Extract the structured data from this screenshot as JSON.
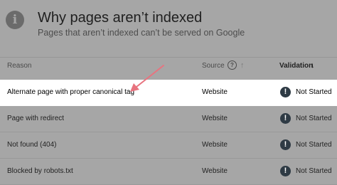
{
  "header": {
    "title": "Why pages aren’t indexed",
    "subtitle": "Pages that aren’t indexed can’t be served on Google",
    "icon_glyph": "i"
  },
  "columns": {
    "reason": "Reason",
    "source": "Source",
    "help_glyph": "?",
    "sort_up_glyph": "↑",
    "validation": "Validation",
    "sort_down_glyph": "↓"
  },
  "rows": [
    {
      "reason": "Alternate page with proper canonical tag",
      "source": "Website",
      "status": "Not Started",
      "highlighted": true
    },
    {
      "reason": "Page with redirect",
      "source": "Website",
      "status": "Not Started",
      "highlighted": false
    },
    {
      "reason": "Not found (404)",
      "source": "Website",
      "status": "Not Started",
      "highlighted": false
    },
    {
      "reason": "Blocked by robots.txt",
      "source": "Website",
      "status": "Not Started",
      "highlighted": false
    }
  ],
  "status_icon_glyph": "!",
  "colors": {
    "overlay": "#a6a6a6",
    "highlight_row": "#ffffff",
    "annotation_arrow": "#e8737f",
    "status_icon": "#2e3a44"
  }
}
